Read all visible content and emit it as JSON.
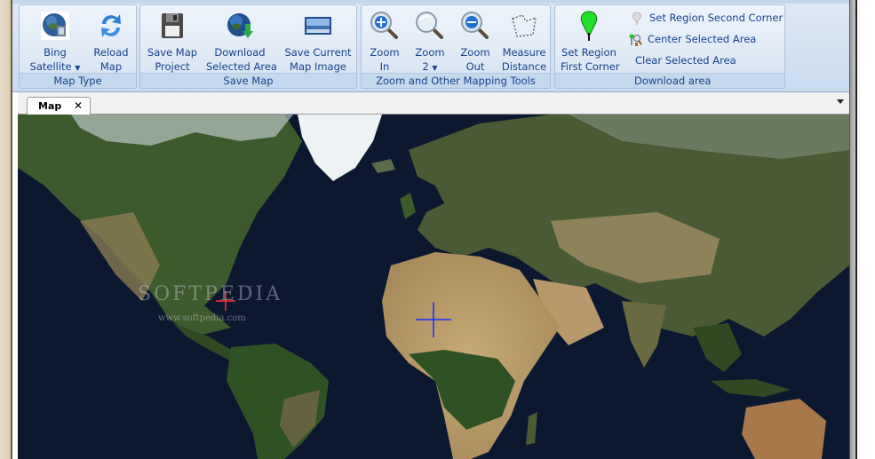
{
  "ribbon": {
    "groups": [
      {
        "label": "Map Type",
        "buttons": [
          {
            "label_line1": "Bing",
            "label_line2": "Satellite",
            "has_dropdown": true,
            "icon": "globe-satellite-icon"
          },
          {
            "label_line1": "Reload",
            "label_line2": "Map",
            "icon": "reload-arrows-icon"
          }
        ]
      },
      {
        "label": "Save Map",
        "buttons": [
          {
            "label_line1": "Save Map",
            "label_line2": "Project",
            "icon": "floppy-disk-icon"
          },
          {
            "label_line1": "Download",
            "label_line2": "Selected Area",
            "icon": "globe-download-icon"
          },
          {
            "label_line1": "Save Current",
            "label_line2": "Map Image",
            "icon": "map-image-icon"
          }
        ]
      },
      {
        "label": "Zoom and Other Mapping Tools",
        "buttons": [
          {
            "label_line1": "Zoom",
            "label_line2": "In",
            "icon": "zoom-in-icon"
          },
          {
            "label_line1": "Zoom",
            "label_line2": "2",
            "has_dropdown": true,
            "icon": "zoom-level-icon"
          },
          {
            "label_line1": "Zoom",
            "label_line2": "Out",
            "icon": "zoom-out-icon"
          },
          {
            "label_line1": "Measure",
            "label_line2": "Distance",
            "icon": "measure-polygon-icon"
          }
        ]
      },
      {
        "label": "Download area",
        "buttons": [
          {
            "label_line1": "Set Region",
            "label_line2": "First Corner",
            "icon": "green-pin-icon"
          }
        ],
        "small_buttons": [
          {
            "label": "Set Region Second Corner",
            "icon": "gray-pin-icon"
          },
          {
            "label": "Center Selected Area",
            "icon": "center-area-icon"
          },
          {
            "label": "Clear Selected Area",
            "icon": ""
          }
        ]
      }
    ]
  },
  "document_tabs": [
    {
      "label": "Map",
      "close": "✕",
      "active": true
    }
  ],
  "map": {
    "watermark": "SOFTPEDIA",
    "watermark_tm": "™",
    "watermark_url": "www.softpedia.com",
    "colors": {
      "ocean": "#0b1830",
      "land_green": "#3f5a2c",
      "desert": "#b89a6a",
      "ice": "#e8eef2",
      "crosshair_center": "#1a2cff",
      "crosshair_marker": "#ff3030"
    }
  }
}
